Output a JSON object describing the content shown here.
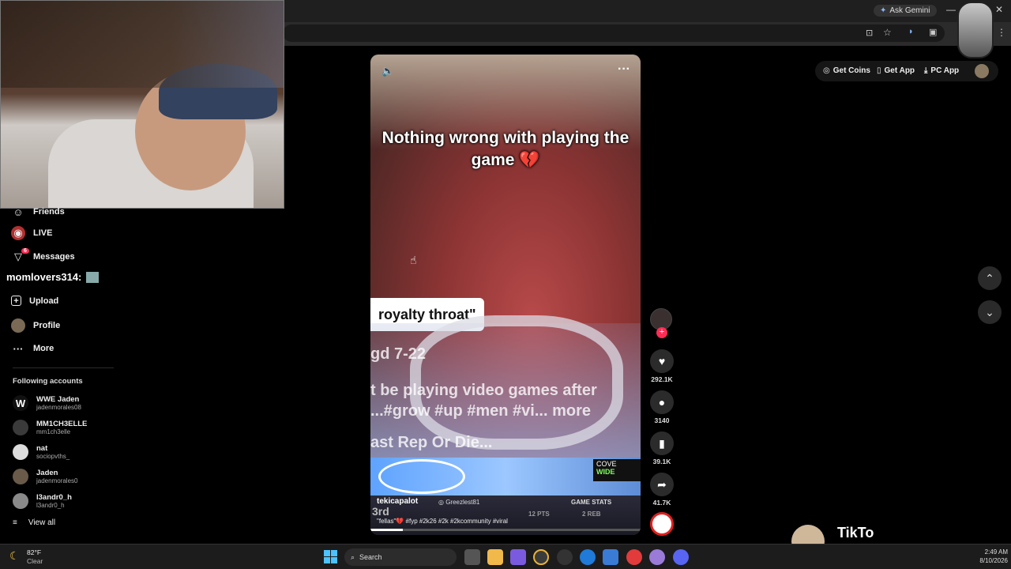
{
  "browser": {
    "ask_gemini": "Ask Gemini"
  },
  "overlay_chat": "momlovers314:",
  "nav": {
    "friends": "Friends",
    "live": "LIVE",
    "messages": "Messages",
    "messages_badge": "6",
    "upload": "Upload",
    "profile": "Profile",
    "more": "More"
  },
  "following": {
    "heading": "Following accounts",
    "accounts": [
      {
        "name": "WWE Jaden",
        "handle": "jadenmorales08"
      },
      {
        "name": "MM1CH3ELLE",
        "handle": "mm1ch3elle"
      },
      {
        "name": "nat",
        "handle": "sociopvths_"
      },
      {
        "name": "Jaden",
        "handle": "jadenmorales0"
      },
      {
        "name": "l3andr0_h",
        "handle": "l3andr0_h"
      }
    ],
    "view_all": "View all"
  },
  "header": {
    "get_coins": "Get Coins",
    "get_app": "Get App",
    "pc_app": "PC App"
  },
  "video": {
    "caption_top": "Nothing wrong with playing the game 💔",
    "quote": "royalty throat\"",
    "overlay_line1": "gd  7-22",
    "overlay_line2": "t be playing video games after",
    "overlay_line3": "...#grow #up #men #vi... more",
    "overlay_line4": "ast Rep Or Die...",
    "corner_label1": "COVE",
    "corner_label2": "WIDE",
    "author": "tekicapalot",
    "game_user": "Greezlest81",
    "game_stats": "GAME STATS",
    "score1": "3rd",
    "stat_reb": "2 REB",
    "stat_pts": "12 PTS",
    "description": "\"fellas\"💔 #fyp #2k26 #2k #2kcommunity #viral"
  },
  "actions": {
    "likes": "292.1K",
    "comments": "3140",
    "saves": "39.1K",
    "shares": "41.7K"
  },
  "taskbar": {
    "temperature": "82°F",
    "weather": "Clear",
    "search": "Search",
    "time": "2:49 AM",
    "date": "8/10/2026"
  },
  "toast": {
    "title": "TikTo",
    "body": "h"
  }
}
